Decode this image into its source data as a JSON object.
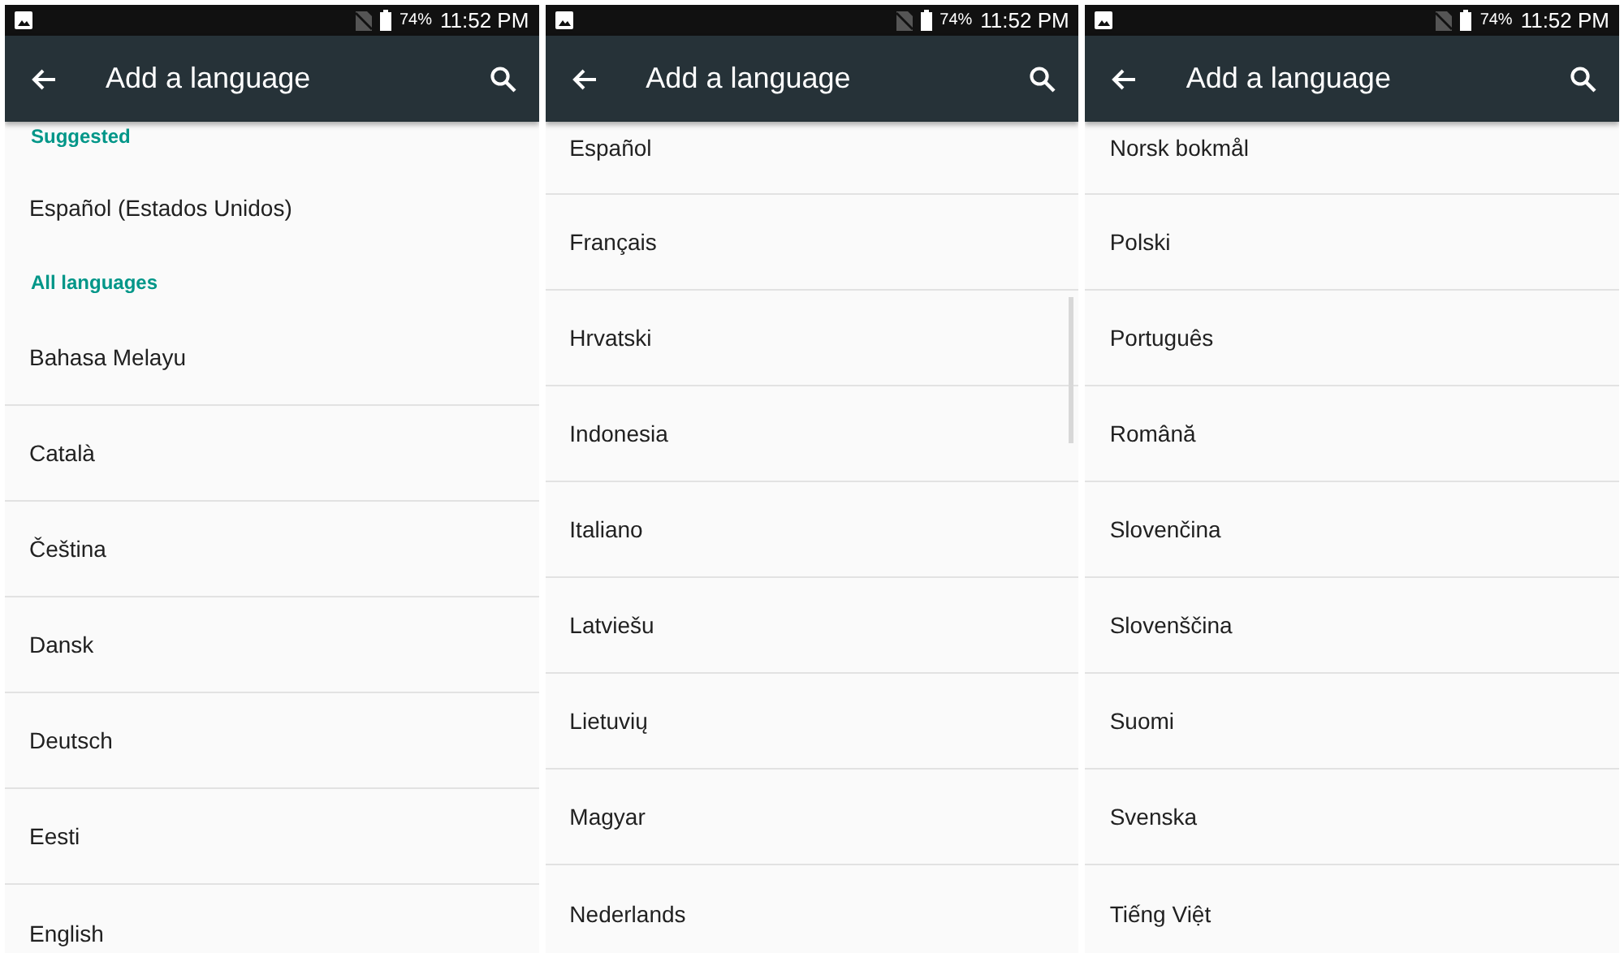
{
  "panels": [
    {
      "status": {
        "battery": "74%",
        "time": "11:52 PM"
      },
      "title": "Add a language",
      "scrollbar_visible": false,
      "items": [
        {
          "kind": "header",
          "label": "Suggested"
        },
        {
          "kind": "language",
          "label": "Español (Estados Unidos)"
        },
        {
          "kind": "header",
          "label": "All languages"
        },
        {
          "kind": "language",
          "label": "Bahasa Melayu"
        },
        {
          "kind": "language",
          "label": "Català"
        },
        {
          "kind": "language",
          "label": "Čeština"
        },
        {
          "kind": "language",
          "label": "Dansk"
        },
        {
          "kind": "language",
          "label": "Deutsch"
        },
        {
          "kind": "language",
          "label": "Eesti"
        },
        {
          "kind": "language",
          "label": "English"
        }
      ]
    },
    {
      "status": {
        "battery": "74%",
        "time": "11:52 PM"
      },
      "title": "Add a language",
      "scrollbar_visible": true,
      "items": [
        {
          "kind": "language",
          "label": "Español"
        },
        {
          "kind": "language",
          "label": "Français"
        },
        {
          "kind": "language",
          "label": "Hrvatski"
        },
        {
          "kind": "language",
          "label": "Indonesia"
        },
        {
          "kind": "language",
          "label": "Italiano"
        },
        {
          "kind": "language",
          "label": "Latviešu"
        },
        {
          "kind": "language",
          "label": "Lietuvių"
        },
        {
          "kind": "language",
          "label": "Magyar"
        },
        {
          "kind": "language",
          "label": "Nederlands"
        }
      ]
    },
    {
      "status": {
        "battery": "74%",
        "time": "11:52 PM"
      },
      "title": "Add a language",
      "scrollbar_visible": false,
      "items": [
        {
          "kind": "language",
          "label": "Norsk bokmål"
        },
        {
          "kind": "language",
          "label": "Polski"
        },
        {
          "kind": "language",
          "label": "Português"
        },
        {
          "kind": "language",
          "label": "Română"
        },
        {
          "kind": "language",
          "label": "Slovenčina"
        },
        {
          "kind": "language",
          "label": "Slovenščina"
        },
        {
          "kind": "language",
          "label": "Suomi"
        },
        {
          "kind": "language",
          "label": "Svenska"
        },
        {
          "kind": "language",
          "label": "Tiếng Việt"
        }
      ]
    }
  ]
}
